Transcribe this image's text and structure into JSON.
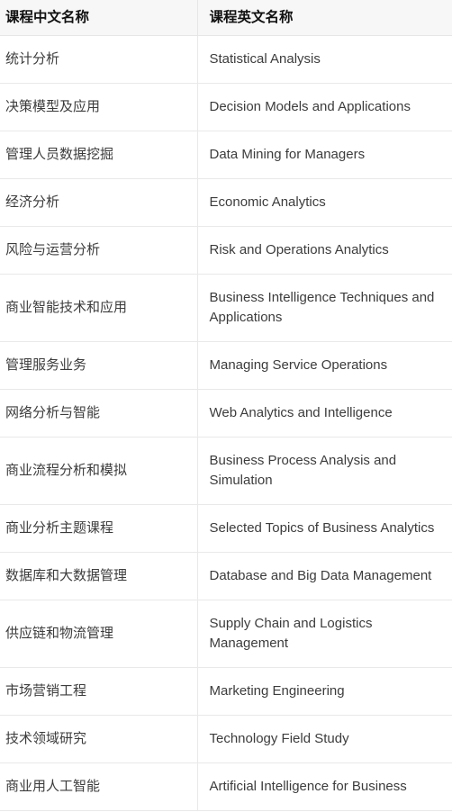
{
  "table": {
    "columns": [
      {
        "key": "cn",
        "label": "课程中文名称"
      },
      {
        "key": "en",
        "label": "课程英文名称"
      }
    ],
    "rows": [
      {
        "cn": "统计分析",
        "en": "Statistical Analysis"
      },
      {
        "cn": "决策模型及应用",
        "en": "Decision Models and Applications"
      },
      {
        "cn": "管理人员数据挖掘",
        "en": "Data Mining for Managers"
      },
      {
        "cn": "经济分析",
        "en": "Economic Analytics"
      },
      {
        "cn": "风险与运营分析",
        "en": "Risk and Operations Analytics"
      },
      {
        "cn": "商业智能技术和应用",
        "en": "Business Intelligence Techniques and Applications"
      },
      {
        "cn": "管理服务业务",
        "en": "Managing Service Operations"
      },
      {
        "cn": "网络分析与智能",
        "en": "Web Analytics and Intelligence"
      },
      {
        "cn": "商业流程分析和模拟",
        "en": "Business Process Analysis and Simulation"
      },
      {
        "cn": "商业分析主题课程",
        "en": "Selected Topics of Business Analytics"
      },
      {
        "cn": "数据库和大数据管理",
        "en": "Database and Big Data Management"
      },
      {
        "cn": "供应链和物流管理",
        "en": "Supply Chain and Logistics Management"
      },
      {
        "cn": "市场营销工程",
        "en": "Marketing Engineering"
      },
      {
        "cn": "技术领域研究",
        "en": "Technology Field Study"
      },
      {
        "cn": "商业用人工智能",
        "en": "Artificial Intelligence for Business"
      }
    ]
  },
  "theme": {
    "header_background": "#f7f7f7",
    "header_text": "#111111",
    "body_text": "#3c3c3c",
    "divider": "#e9e9e9",
    "page_background": "#ffffff"
  }
}
